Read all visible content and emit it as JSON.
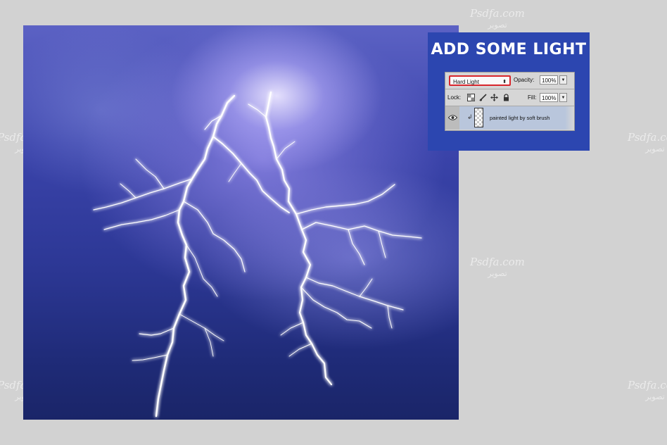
{
  "panel": {
    "title": "ADD SOME LIGHT"
  },
  "layers_panel": {
    "blend_mode": "Hard Light",
    "opacity_label": "Opacity:",
    "opacity_value": "100%",
    "lock_label": "Lock:",
    "fill_label": "Fill:",
    "fill_value": "100%",
    "layer_name": "painted light by soft brush",
    "lock_icons": [
      "lock-transparent-pixels-icon",
      "lock-image-pixels-icon",
      "lock-position-icon",
      "lock-all-icon"
    ]
  },
  "watermark": {
    "text": "Psdfa.com",
    "sub": "ﺗﺼﻮﻳﺮ"
  },
  "colors": {
    "panel_bg": "#2c46b0",
    "highlight": "#d8262c",
    "background": "#d2d2d2"
  }
}
